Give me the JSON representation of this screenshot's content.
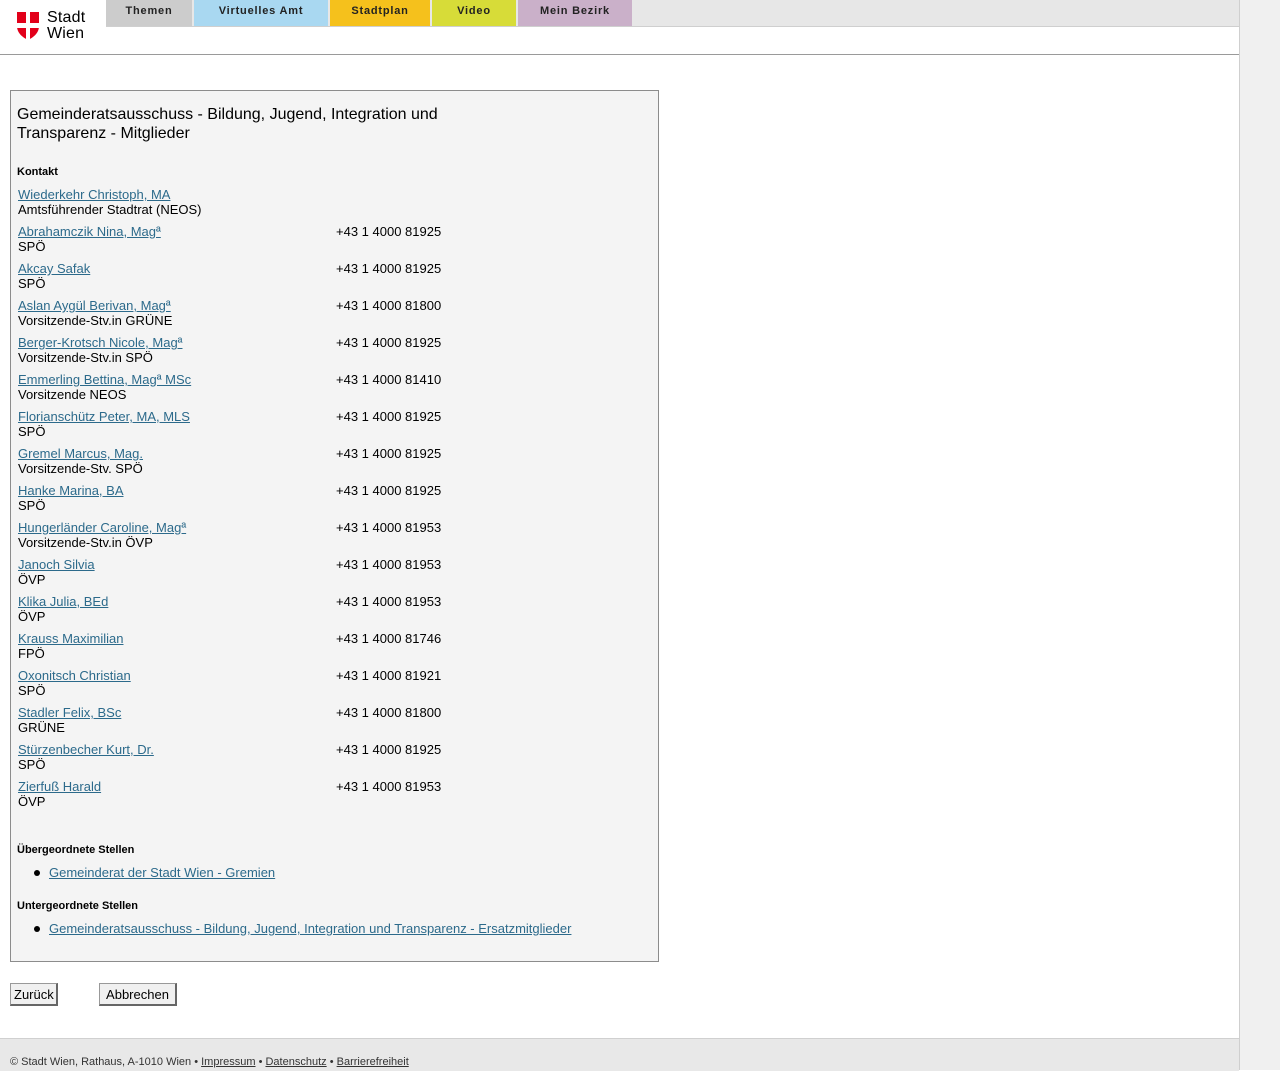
{
  "header": {
    "logo_line1": "Stadt",
    "logo_line2": "Wien",
    "nav": [
      {
        "label": "Themen",
        "color": "#cccccc"
      },
      {
        "label": "Virtuelles Amt",
        "color": "#a9d8f1"
      },
      {
        "label": "Stadtplan",
        "color": "#f5c11c"
      },
      {
        "label": "Video",
        "color": "#d7dc38"
      },
      {
        "label": "Mein Bezirk",
        "color": "#cab0c9"
      }
    ],
    "accent_red": "#e2001a"
  },
  "panel": {
    "title": "Gemeinderatsausschuss - Bildung, Jugend, Integration und Transparenz - Mitglieder",
    "contact_label": "Kontakt",
    "members": [
      {
        "name": "Wiederkehr Christoph, MA",
        "role": "Amtsführender Stadtrat (NEOS)",
        "phone": ""
      },
      {
        "name": "Abrahamczik Nina, Magª",
        "role": "SPÖ",
        "phone": "+43 1 4000 81925"
      },
      {
        "name": "Akcay Safak",
        "role": "SPÖ",
        "phone": "+43 1 4000 81925"
      },
      {
        "name": "Aslan Aygül Berivan, Magª",
        "role": "Vorsitzende-Stv.in GRÜNE",
        "phone": "+43 1 4000 81800"
      },
      {
        "name": "Berger-Krotsch Nicole, Magª",
        "role": "Vorsitzende-Stv.in SPÖ",
        "phone": "+43 1 4000 81925"
      },
      {
        "name": "Emmerling Bettina, Magª MSc",
        "role": "Vorsitzende NEOS",
        "phone": "+43 1 4000 81410"
      },
      {
        "name": "Florianschütz Peter, MA, MLS",
        "role": "SPÖ",
        "phone": "+43 1 4000 81925"
      },
      {
        "name": "Gremel Marcus, Mag.",
        "role": "Vorsitzende-Stv. SPÖ",
        "phone": "+43 1 4000 81925"
      },
      {
        "name": "Hanke Marina, BA",
        "role": "SPÖ",
        "phone": "+43 1 4000 81925"
      },
      {
        "name": "Hungerländer Caroline, Magª",
        "role": "Vorsitzende-Stv.in ÖVP",
        "phone": "+43 1 4000 81953"
      },
      {
        "name": "Janoch Silvia",
        "role": "ÖVP",
        "phone": "+43 1 4000 81953"
      },
      {
        "name": "Klika Julia, BEd",
        "role": "ÖVP",
        "phone": "+43 1 4000 81953"
      },
      {
        "name": "Krauss Maximilian",
        "role": "FPÖ",
        "phone": "+43 1 4000 81746"
      },
      {
        "name": "Oxonitsch Christian",
        "role": "SPÖ",
        "phone": "+43 1 4000 81921"
      },
      {
        "name": "Stadler Felix, BSc",
        "role": "GRÜNE",
        "phone": "+43 1 4000 81800"
      },
      {
        "name": "Stürzenbecher Kurt, Dr.",
        "role": "SPÖ",
        "phone": "+43 1 4000 81925"
      },
      {
        "name": "Zierfuß Harald",
        "role": "ÖVP",
        "phone": "+43 1 4000 81953"
      }
    ],
    "superior_label": "Übergeordnete Stellen",
    "superior_links": [
      "Gemeinderat der Stadt Wien - Gremien"
    ],
    "subordinate_label": "Untergeordnete Stellen",
    "subordinate_links": [
      "Gemeinderatsausschuss - Bildung, Jugend, Integration und Transparenz - Ersatzmitglieder"
    ]
  },
  "buttons": {
    "back": "Zurück",
    "cancel": "Abbrechen"
  },
  "footer": {
    "copyright": "© Stadt Wien, Rathaus, A-1010 Wien • ",
    "impressum": "Impressum",
    "sep1": " • ",
    "datenschutz": "Datenschutz",
    "sep2": " • ",
    "barrierefreiheit": "Barrierefreiheit"
  }
}
